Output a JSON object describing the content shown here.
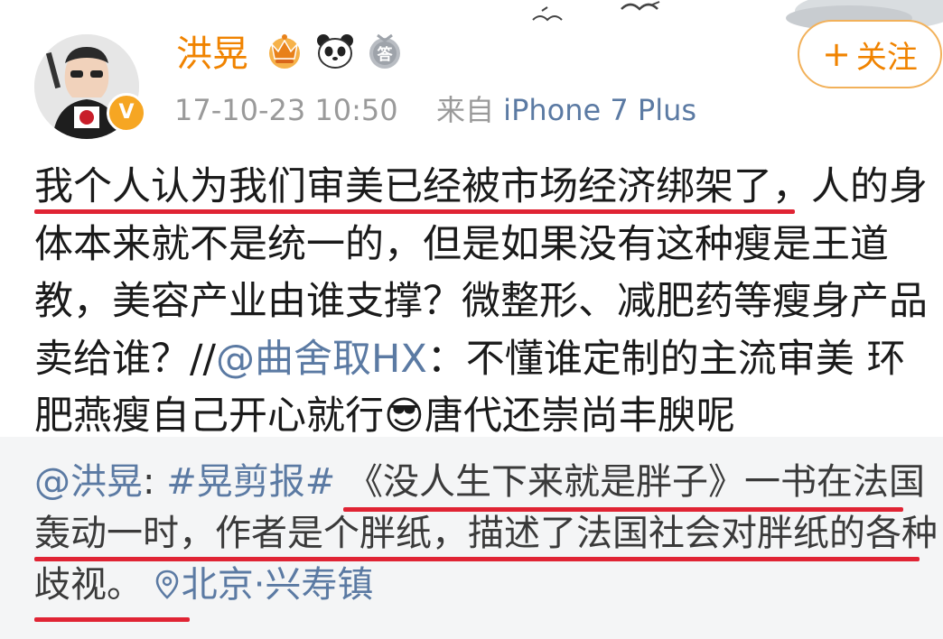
{
  "header": {
    "username": "洪晃",
    "badges": [
      "crown-badge",
      "panda-badge",
      "answer-badge"
    ],
    "answer_badge_text": "答",
    "verified_mark": "V",
    "timestamp": "17-10-23 10:50",
    "source_prefix": "来自",
    "device": "iPhone 7 Plus",
    "follow_label": "关注",
    "follow_plus": "+"
  },
  "post": {
    "text_part1": "我个人认为我们审美已经被市场经济绑架了，人的身体本来就不是统一的，但是如果没有这种瘦是王道教，美容产业由谁支撑？微整形、减肥药等瘦身产品卖给谁？//",
    "mention": "@曲舍取HX",
    "text_part2": "：不懂谁定制的主流审美 环肥燕瘦自己开心就行",
    "emoji": "😎",
    "text_part3": "唐代还崇尚丰腴呢"
  },
  "repost": {
    "mention": "@洪晃",
    "separator": ": ",
    "topic": "#晃剪报#",
    "text": " 《没人生下来就是胖子》一书在法国轰动一时，作者是个胖纸，描述了法国社会对胖纸的各种歧视。 ",
    "location": "北京·兴寿镇"
  },
  "colors": {
    "username": "#f08300",
    "link": "#5b7aa3",
    "underline": "#e02434",
    "repost_bg": "#f4f5f6",
    "meta": "#9a9a9a"
  }
}
